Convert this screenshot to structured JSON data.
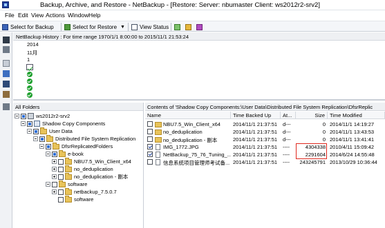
{
  "window": {
    "title": "Backup, Archive, and Restore - NetBackup - [Restore: Server: nbumaster   Client: ws2012r2-srv2]"
  },
  "menu": [
    "File",
    "Edit",
    "View",
    "Actions",
    "Window",
    "Help"
  ],
  "toolbar": {
    "select_backup": "Select for Backup",
    "select_restore": "Select for Restore",
    "view_status": "View Status"
  },
  "history": {
    "header": "NetBackup History : For time range 1970/1/1 8:00:00 to 2015/11/1 21:53:24",
    "year": "2014",
    "month": "11月",
    "day": "1"
  },
  "folders": {
    "header": "All Folders",
    "nodes": [
      "ws2012r2-srv2",
      "Shadow Copy Components",
      "User Data",
      "Distributed File System Replication",
      "DfsrReplicatedFolders",
      "e-book",
      "NBU7.5_Win_Client_x64",
      "no_deduplication",
      "no_deduplication - 副本",
      "software",
      "netbackup_7.5.0.7",
      "software"
    ]
  },
  "contents": {
    "header": "Contents of 'Shadow Copy Components:\\User Data\\Distributed File System Replication\\DfsrReplic",
    "columns": [
      "Name",
      "Time Backed Up",
      "At...",
      "Size",
      "Time Modified"
    ],
    "rows": [
      {
        "name": "NBU7.5_Win_Client_x64",
        "backed": "2014/11/1 21:37:51",
        "attr": "d---",
        "size": "0",
        "modified": "2014/11/1 14:19:27",
        "type": "folder",
        "checked": false
      },
      {
        "name": "no_deduplication",
        "backed": "2014/11/1 21:37:51",
        "attr": "d---",
        "size": "0",
        "modified": "2014/11/1 13:43:53",
        "type": "folder",
        "checked": false
      },
      {
        "name": "no_deduplication - 副本",
        "backed": "2014/11/1 21:37:51",
        "attr": "d---",
        "size": "0",
        "modified": "2014/11/1 13:41:41",
        "type": "folder",
        "checked": false
      },
      {
        "name": "IMG_1772.JPG",
        "backed": "2014/11/1 21:37:51",
        "attr": "----",
        "size": "4304338",
        "modified": "2010/4/11 15:09:42",
        "type": "file",
        "checked": true
      },
      {
        "name": "NetBackup_75_76_Tuning_...",
        "backed": "2014/11/1 21:37:51",
        "attr": "----",
        "size": "2291604",
        "modified": "2014/6/24 14:55:48",
        "type": "file",
        "checked": true
      },
      {
        "name": "信息系统项目管理师考试备...",
        "backed": "2014/11/1 21:37:51",
        "attr": "----",
        "size": "243245791",
        "modified": "2013/10/29 10:36:44",
        "type": "file",
        "checked": false
      }
    ]
  },
  "colors": {
    "highlight": "#e0281e",
    "check": "#1fa02f"
  }
}
